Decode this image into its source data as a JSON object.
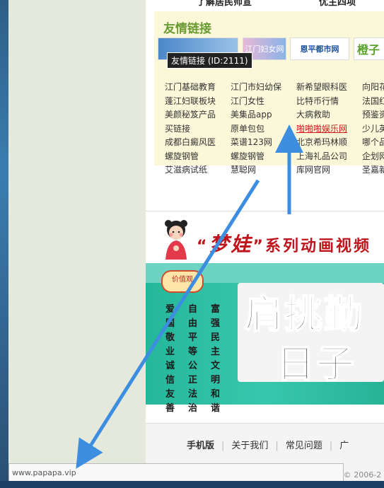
{
  "top_cut": {
    "left_text": "了解居民师宣",
    "right_text": "优主四项"
  },
  "links_section": {
    "title": "友情链接",
    "tooltip": "友情链接 (ID:2111)",
    "logos": [
      {
        "name": "logo-jiangmen-women",
        "label": "江门妇女网"
      },
      {
        "name": "logo-enping",
        "label": "恩平都市网"
      },
      {
        "name": "logo-cheng",
        "label": "橙子"
      }
    ],
    "rows": [
      [
        "江门基础教育",
        "江门市妇幼保",
        "新希望眼科医",
        "向阳花"
      ],
      [
        "蓬江妇联板块",
        "江门女性",
        "比特币行情",
        "法国红"
      ],
      [
        "美颜秘笈产品",
        "美集品app",
        "大病救助",
        "预鉴资"
      ],
      [
        "买链接",
        "原单包包",
        "啪啪啪娱乐网",
        "少儿英"
      ],
      [
        "成都白癜风医",
        "菜谱123网",
        "北京希玛林顺",
        "哪个品"
      ],
      [
        "螺旋钢管",
        "螺旋钢管",
        "上海礼品公司",
        "企划网"
      ],
      [
        "艾滋病试纸",
        "慧聪网",
        "库网官网",
        "圣嘉新"
      ]
    ]
  },
  "banner": {
    "title_prefix": "“",
    "title_dream": "梦娃",
    "title_suffix": "”系列动画视频",
    "badge": "价值观",
    "values": [
      "爱",
      "自",
      "富",
      "国",
      "由",
      "强",
      "敬",
      "平",
      "民",
      "业",
      "等",
      "主",
      "诚",
      "公",
      "文",
      "信",
      "正",
      "明",
      "友",
      "法",
      "和",
      "善",
      "治",
      "谐"
    ],
    "slogan_line1": "肩挑勤",
    "slogan_line2": "日子"
  },
  "footer": {
    "nav": [
      "手机版",
      "关于我们",
      "常见问题",
      "广"
    ],
    "copyright": "t © 2006-2"
  },
  "status_bar": {
    "url": "www.papapa.vip"
  },
  "colors": {
    "accent_green": "#6a9a32",
    "link_red": "#d31a1a",
    "arrow_blue": "#3d8ee0",
    "banner_teal": "#2fbfa4"
  }
}
